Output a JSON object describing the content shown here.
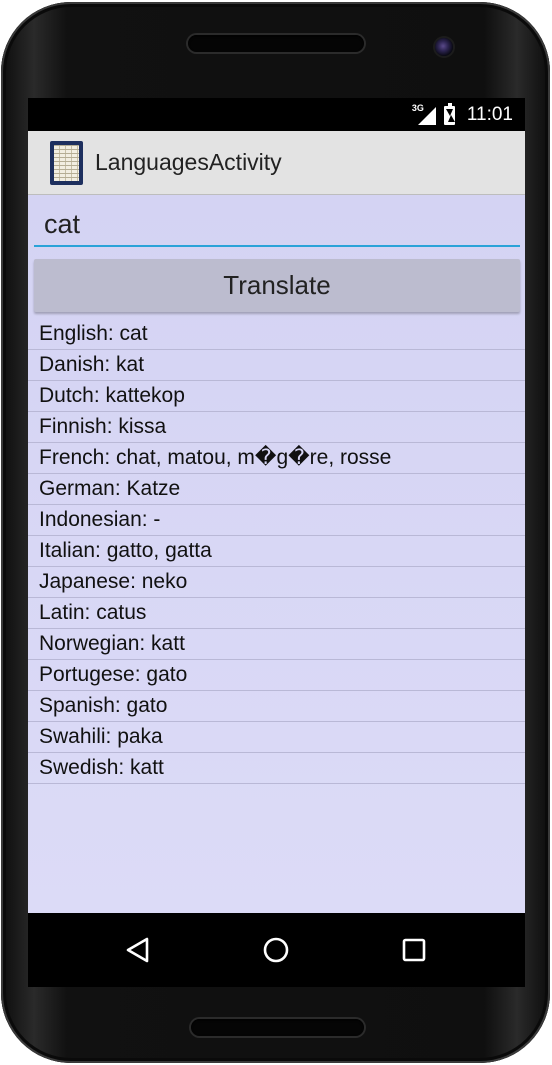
{
  "status_bar": {
    "network": "3G",
    "time": "11:01"
  },
  "app_bar": {
    "title": "LanguagesActivity",
    "icon": "dictionary-app-icon"
  },
  "search": {
    "value": "cat",
    "placeholder": ""
  },
  "translate_button": {
    "label": "Translate"
  },
  "results": [
    "English: cat",
    "Danish: kat",
    "Dutch: kattekop",
    "Finnish: kissa",
    "French: chat, matou, m�g�re, rosse",
    "German: Katze",
    "Indonesian: -",
    "Italian: gatto, gatta",
    "Japanese: neko",
    "Latin: catus",
    "Norwegian: katt",
    "Portugese: gato",
    "Spanish: gato",
    "Swahili: paka",
    "Swedish: katt"
  ],
  "nav_bar": {
    "back_icon": "back-triangle-icon",
    "home_icon": "home-circle-icon",
    "recents_icon": "recents-square-icon"
  },
  "colors": {
    "content_background": "#d4d3f3",
    "app_bar": "#e3e3e3",
    "input_underline": "#2aa3d8",
    "button": "#bcbccf"
  }
}
